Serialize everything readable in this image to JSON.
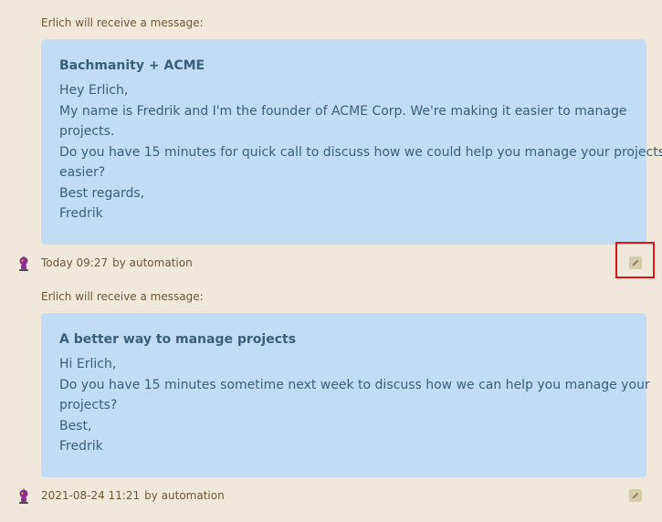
{
  "messages": [
    {
      "recipient_label": "Erlich will receive a message:",
      "subject": "Bachmanity + ACME",
      "body_lines": [
        "Hey Erlich,",
        "My name is Fredrik and I'm the founder of ACME Corp. We're making it easier to manage",
        "projects.",
        "Do you have 15 minutes for quick call to discuss how we could help you manage your projects",
        "easier?",
        "Best regards,",
        "Fredrik"
      ],
      "timestamp": "Today 09:27",
      "author": "by automation"
    },
    {
      "recipient_label": "Erlich will receive a message:",
      "subject": "A better way to manage projects",
      "body_lines": [
        "Hi Erlich,",
        "Do you have 15 minutes sometime next week to discuss how we can help you manage your",
        "projects?",
        "Best,",
        "Fredrik"
      ],
      "timestamp": "2021-08-24 11:21",
      "author": "by automation"
    }
  ],
  "icons": {
    "avatar": "robot-avatar-icon",
    "edit": "pencil-icon"
  },
  "colors": {
    "background": "#f0e8db",
    "card": "#c3dcf5",
    "card_text": "#355f7d",
    "meta_text": "#6e5634",
    "highlight": "#e0151c"
  }
}
